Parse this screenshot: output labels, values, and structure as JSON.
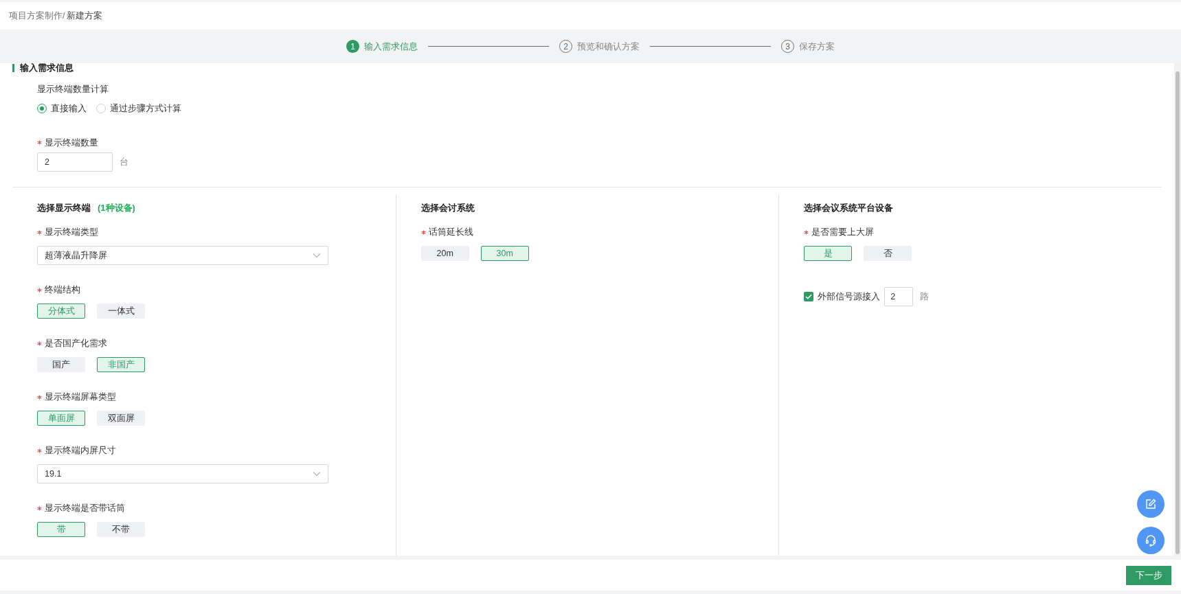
{
  "breadcrumb": {
    "parent": "项目方案制作/",
    "current": "新建方案"
  },
  "steps": [
    {
      "number": "1",
      "label": "输入需求信息",
      "selected": true
    },
    {
      "number": "2",
      "label": "预览和确认方案",
      "selected": false
    },
    {
      "number": "3",
      "label": "保存方案",
      "selected": false
    }
  ],
  "section_title": "输入需求信息",
  "count_mode": {
    "label": "显示终端数量计算",
    "options": [
      {
        "label": "直接输入",
        "selected": true
      },
      {
        "label": "通过步骤方式计算",
        "selected": false
      }
    ]
  },
  "count": {
    "label": "显示终端数量",
    "required": true,
    "value": "2",
    "unit": "台"
  },
  "columns": [
    {
      "title": "选择显示终端",
      "title_note": "(1种设备)",
      "fields": [
        {
          "kind": "select",
          "label": "显示终端类型",
          "required": true,
          "value": "超薄液晶升降屏"
        },
        {
          "kind": "toggle",
          "label": "终端结构",
          "required": true,
          "options": [
            {
              "label": "分体式",
              "selected": true
            },
            {
              "label": "一体式",
              "selected": false
            }
          ]
        },
        {
          "kind": "toggle",
          "label": "是否国产化需求",
          "required": true,
          "options": [
            {
              "label": "国产",
              "selected": false
            },
            {
              "label": "非国产",
              "selected": true
            }
          ]
        },
        {
          "kind": "toggle",
          "label": "显示终端屏幕类型",
          "required": true,
          "options": [
            {
              "label": "单面屏",
              "selected": true
            },
            {
              "label": "双面屏",
              "selected": false
            }
          ]
        },
        {
          "kind": "select",
          "label": "显示终端内屏尺寸",
          "required": true,
          "value": "19.1"
        },
        {
          "kind": "toggle",
          "label": "显示终端是否带话筒",
          "required": true,
          "options": [
            {
              "label": "带",
              "selected": true
            },
            {
              "label": "不带",
              "selected": false
            }
          ]
        }
      ]
    },
    {
      "title": "选择会讨系统",
      "fields": [
        {
          "kind": "toggle",
          "label": "话筒延长线",
          "required": true,
          "options": [
            {
              "label": "20m",
              "selected": false
            },
            {
              "label": "30m",
              "selected": true
            }
          ]
        }
      ]
    },
    {
      "title": "选择会议系统平台设备",
      "fields": [
        {
          "kind": "toggle",
          "label": "是否需要上大屏",
          "required": true,
          "options": [
            {
              "label": "是",
              "selected": true
            },
            {
              "label": "否",
              "selected": false
            }
          ]
        },
        {
          "kind": "checkbox_input",
          "label": "外部信号源接入",
          "checked": true,
          "value": "2",
          "unit": "路"
        }
      ]
    }
  ],
  "next_button": "下一步"
}
